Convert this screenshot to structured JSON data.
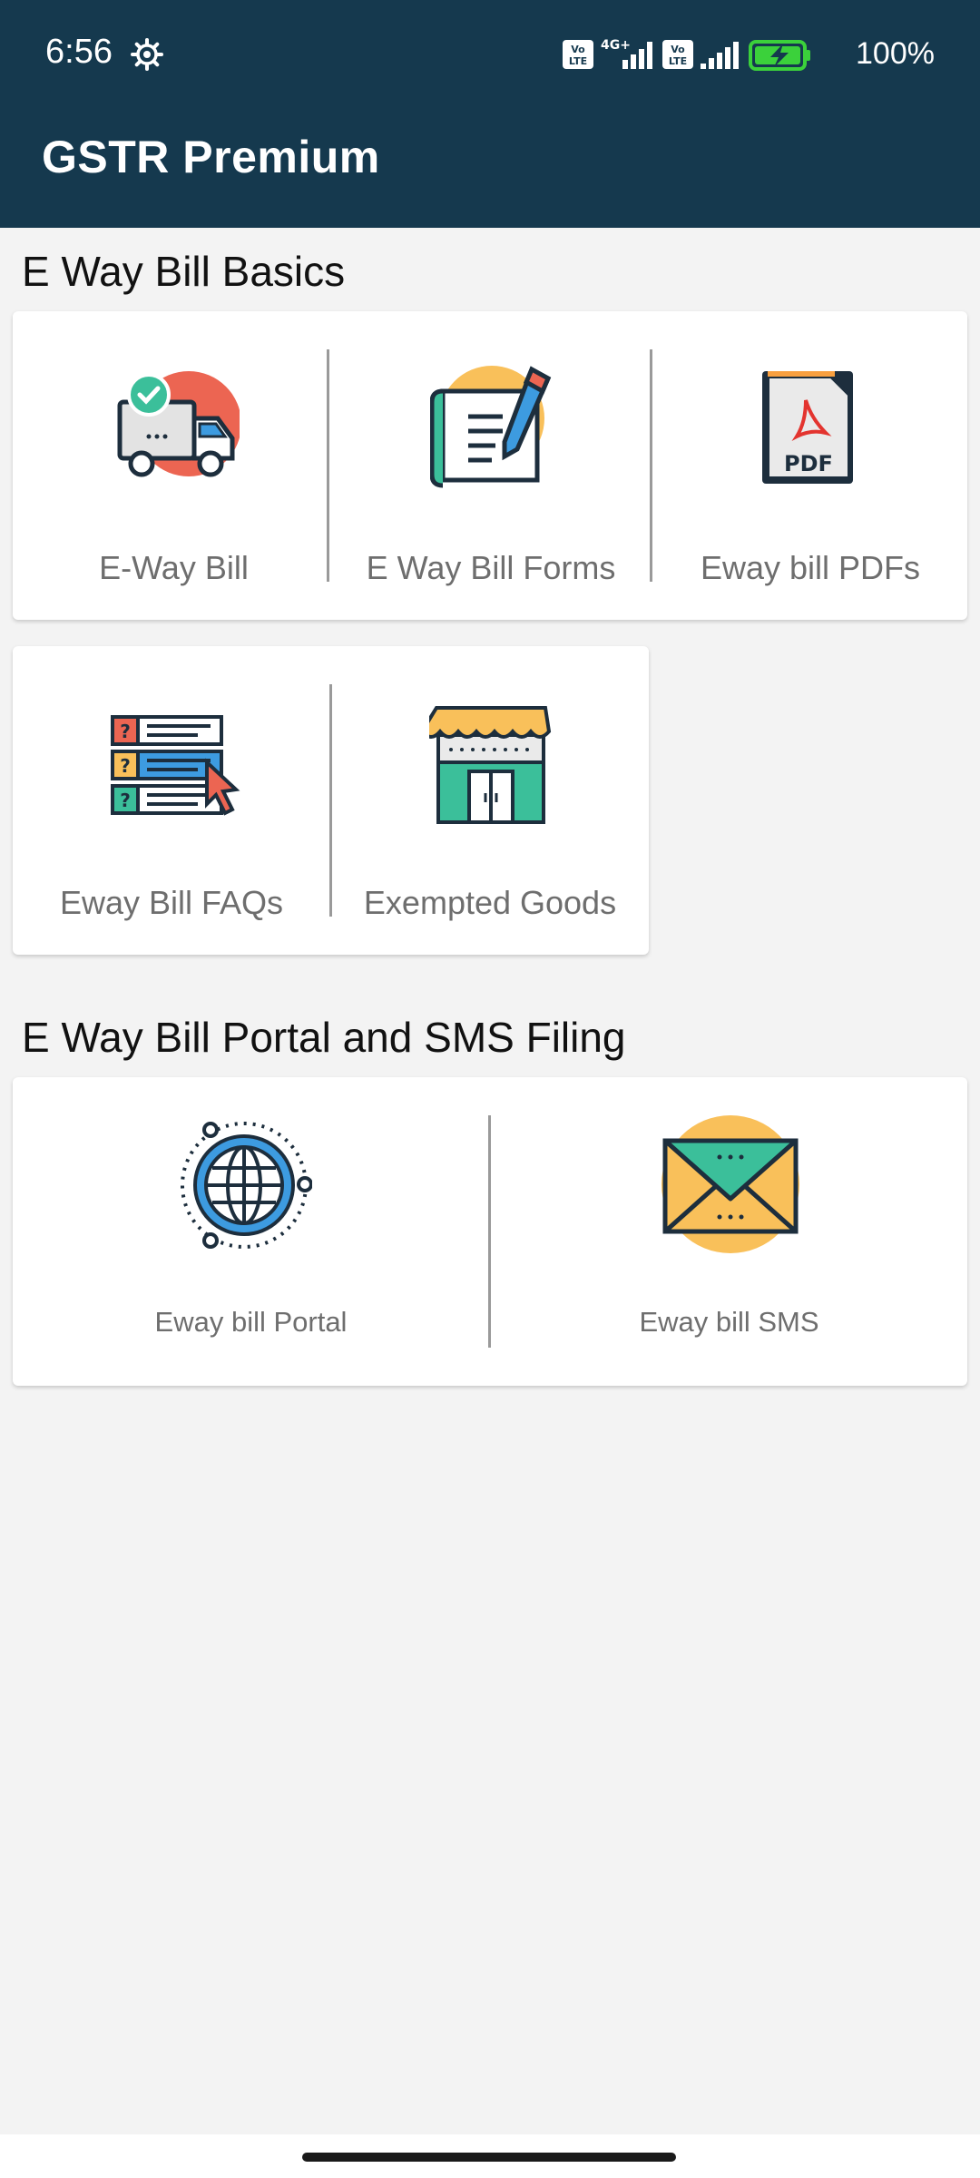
{
  "status_bar": {
    "time": "6:56",
    "battery": "100%",
    "icons": [
      "settings-gear-icon",
      "volte-icon",
      "4g-signal-icon",
      "volte-icon",
      "signal-icon",
      "battery-charging-icon"
    ]
  },
  "app_bar": {
    "title": "GSTR Premium"
  },
  "sections": [
    {
      "title": "E Way Bill Basics",
      "rows": [
        [
          {
            "label": "E-Way Bill",
            "icon": "delivery-truck-icon"
          },
          {
            "label": "E Way Bill Forms",
            "icon": "form-document-pen-icon"
          },
          {
            "label": "Eway bill PDFs",
            "icon": "pdf-file-icon"
          }
        ],
        [
          {
            "label": "Eway Bill FAQs",
            "icon": "faq-list-icon"
          },
          {
            "label": "Exempted Goods",
            "icon": "storefront-icon"
          }
        ]
      ]
    },
    {
      "title": "E Way Bill Portal and SMS Filing",
      "rows": [
        [
          {
            "label": "Eway bill Portal",
            "icon": "globe-icon"
          },
          {
            "label": "Eway bill SMS",
            "icon": "envelope-icon"
          }
        ]
      ]
    }
  ],
  "colors": {
    "app_bar": "#15394e",
    "background": "#f3f3f3",
    "label": "#6e6e6e"
  }
}
